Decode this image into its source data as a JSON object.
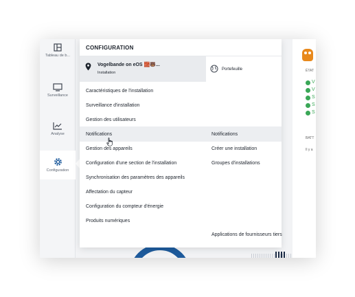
{
  "nav": {
    "items": [
      {
        "label": "Tableau de b...",
        "icon": "dashboard-icon"
      },
      {
        "label": "Surveillance",
        "icon": "monitor-icon"
      },
      {
        "label": "Analyse",
        "icon": "chart-icon"
      },
      {
        "label": "Configuration",
        "icon": "gear-icon",
        "active": true
      }
    ]
  },
  "popup": {
    "title": "CONFIGURATION",
    "site": {
      "name": "Vogelbande on eOS 🧱🐻...",
      "type": "Installation"
    },
    "portfolio_label": "Portefeuille",
    "left_menu": [
      "Caractéristiques de l'installation",
      "Surveillance d'installation",
      "Gestion des utilisateurs",
      "Notifications",
      "Gestion des appareils",
      "Configuration d'une section de l'installation",
      "Synchronisation des paramètres des appareils",
      "Affectation du capteur",
      "Configuration du compteur d'énergie",
      "Produits numériques"
    ],
    "right_menu": [
      "Notifications",
      "Créer une installation",
      "Groupes d'installations",
      "Applications de fournisseurs tiers"
    ]
  },
  "background": {
    "status_title": "ÉTAT",
    "status_rows": [
      "V",
      "V",
      "S",
      "S",
      "S"
    ],
    "battery_label": "BATT",
    "battery_sub": "Il y a"
  },
  "colors": {
    "accent": "#1e5b9c",
    "ok": "#3aa757",
    "text": "#1d232c"
  }
}
